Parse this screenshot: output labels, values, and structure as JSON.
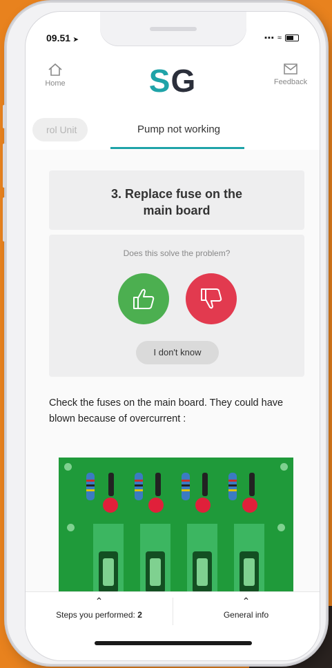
{
  "status_bar": {
    "time": "09.51",
    "signal": "▪▪▪",
    "wifi": "≈"
  },
  "header": {
    "home_label": "Home",
    "logo_s": "S",
    "logo_g": "G",
    "feedback_label": "Feedback"
  },
  "tabs": {
    "previous": "rol Unit",
    "active": "Pump not working"
  },
  "step": {
    "title": "3. Replace fuse on the main board",
    "question": "Does this solve the problem?",
    "dont_know_label": "I don't know",
    "description": "Check the fuses on the main board. They could have blown because of overcurrent :"
  },
  "footer": {
    "steps_label": "Steps you performed: ",
    "steps_count": "2",
    "general_info_label": "General info"
  },
  "colors": {
    "accent": "#1fa3a8",
    "yes": "#4caf50",
    "no": "#e23a4f",
    "background": "#e8821e"
  }
}
